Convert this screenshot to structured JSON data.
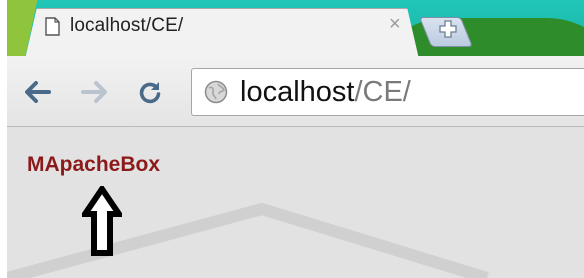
{
  "tab": {
    "title": "localhost/CE/",
    "close": "×"
  },
  "address": {
    "host": "localhost",
    "path": "/CE/"
  },
  "page": {
    "brand": "MApacheBox"
  },
  "colors": {
    "brand": "#8b1a1a",
    "accent": "#1ab3a6"
  },
  "icons": [
    "page-icon",
    "close-icon",
    "new-tab-icon",
    "back-arrow-icon",
    "forward-arrow-icon",
    "reload-icon",
    "globe-icon",
    "up-arrow-icon"
  ]
}
